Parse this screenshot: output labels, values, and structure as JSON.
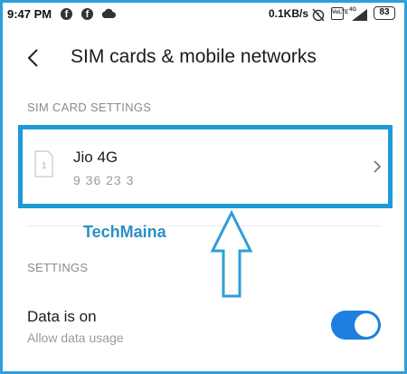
{
  "status_bar": {
    "time": "9:47 PM",
    "fb_glyph": "f",
    "data_speed": "0.1KB/s",
    "network_badge": "4G",
    "volte_badge": "VoLTE",
    "battery": "83",
    "icons": [
      "facebook-icon",
      "facebook-icon",
      "cloud-icon",
      "alarm-off-icon",
      "volte-icon",
      "signal-icon",
      "battery-icon"
    ]
  },
  "header": {
    "title": "SIM cards & mobile networks",
    "back_icon": "chevron-left-icon"
  },
  "sim_section": {
    "heading": "SIM CARD SETTINGS",
    "sim": {
      "slot_label": "1",
      "name": "Jio 4G",
      "number": "9   36   23   3",
      "chevron_icon": "chevron-right-icon"
    }
  },
  "watermark": "TechMaina",
  "settings_section": {
    "heading": "SETTINGS",
    "data_toggle": {
      "title": "Data is on",
      "subtitle": "Allow data usage",
      "state": "on"
    }
  },
  "colors": {
    "highlight_border": "#1e9ad6",
    "toggle_on": "#1e7fe0",
    "watermark": "#2a8fc8",
    "arrow": "#2e9fd6"
  }
}
